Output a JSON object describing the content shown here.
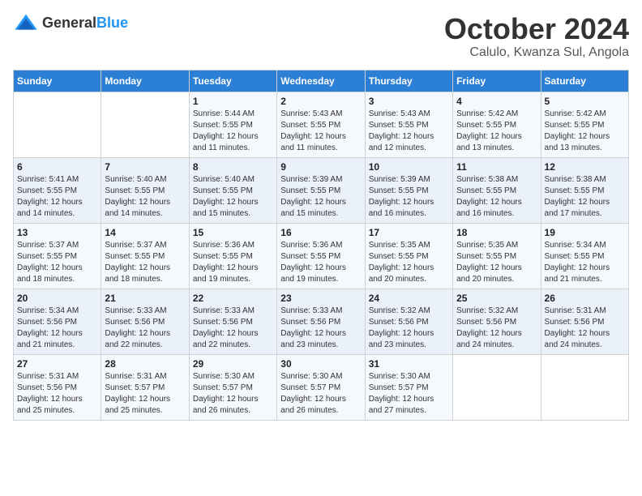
{
  "header": {
    "logo_general": "General",
    "logo_blue": "Blue",
    "month_title": "October 2024",
    "subtitle": "Calulo, Kwanza Sul, Angola"
  },
  "weekdays": [
    "Sunday",
    "Monday",
    "Tuesday",
    "Wednesday",
    "Thursday",
    "Friday",
    "Saturday"
  ],
  "weeks": [
    [
      {
        "day": "",
        "sunrise": "",
        "sunset": "",
        "daylight": ""
      },
      {
        "day": "",
        "sunrise": "",
        "sunset": "",
        "daylight": ""
      },
      {
        "day": "1",
        "sunrise": "Sunrise: 5:44 AM",
        "sunset": "Sunset: 5:55 PM",
        "daylight": "Daylight: 12 hours and 11 minutes."
      },
      {
        "day": "2",
        "sunrise": "Sunrise: 5:43 AM",
        "sunset": "Sunset: 5:55 PM",
        "daylight": "Daylight: 12 hours and 11 minutes."
      },
      {
        "day": "3",
        "sunrise": "Sunrise: 5:43 AM",
        "sunset": "Sunset: 5:55 PM",
        "daylight": "Daylight: 12 hours and 12 minutes."
      },
      {
        "day": "4",
        "sunrise": "Sunrise: 5:42 AM",
        "sunset": "Sunset: 5:55 PM",
        "daylight": "Daylight: 12 hours and 13 minutes."
      },
      {
        "day": "5",
        "sunrise": "Sunrise: 5:42 AM",
        "sunset": "Sunset: 5:55 PM",
        "daylight": "Daylight: 12 hours and 13 minutes."
      }
    ],
    [
      {
        "day": "6",
        "sunrise": "Sunrise: 5:41 AM",
        "sunset": "Sunset: 5:55 PM",
        "daylight": "Daylight: 12 hours and 14 minutes."
      },
      {
        "day": "7",
        "sunrise": "Sunrise: 5:40 AM",
        "sunset": "Sunset: 5:55 PM",
        "daylight": "Daylight: 12 hours and 14 minutes."
      },
      {
        "day": "8",
        "sunrise": "Sunrise: 5:40 AM",
        "sunset": "Sunset: 5:55 PM",
        "daylight": "Daylight: 12 hours and 15 minutes."
      },
      {
        "day": "9",
        "sunrise": "Sunrise: 5:39 AM",
        "sunset": "Sunset: 5:55 PM",
        "daylight": "Daylight: 12 hours and 15 minutes."
      },
      {
        "day": "10",
        "sunrise": "Sunrise: 5:39 AM",
        "sunset": "Sunset: 5:55 PM",
        "daylight": "Daylight: 12 hours and 16 minutes."
      },
      {
        "day": "11",
        "sunrise": "Sunrise: 5:38 AM",
        "sunset": "Sunset: 5:55 PM",
        "daylight": "Daylight: 12 hours and 16 minutes."
      },
      {
        "day": "12",
        "sunrise": "Sunrise: 5:38 AM",
        "sunset": "Sunset: 5:55 PM",
        "daylight": "Daylight: 12 hours and 17 minutes."
      }
    ],
    [
      {
        "day": "13",
        "sunrise": "Sunrise: 5:37 AM",
        "sunset": "Sunset: 5:55 PM",
        "daylight": "Daylight: 12 hours and 18 minutes."
      },
      {
        "day": "14",
        "sunrise": "Sunrise: 5:37 AM",
        "sunset": "Sunset: 5:55 PM",
        "daylight": "Daylight: 12 hours and 18 minutes."
      },
      {
        "day": "15",
        "sunrise": "Sunrise: 5:36 AM",
        "sunset": "Sunset: 5:55 PM",
        "daylight": "Daylight: 12 hours and 19 minutes."
      },
      {
        "day": "16",
        "sunrise": "Sunrise: 5:36 AM",
        "sunset": "Sunset: 5:55 PM",
        "daylight": "Daylight: 12 hours and 19 minutes."
      },
      {
        "day": "17",
        "sunrise": "Sunrise: 5:35 AM",
        "sunset": "Sunset: 5:55 PM",
        "daylight": "Daylight: 12 hours and 20 minutes."
      },
      {
        "day": "18",
        "sunrise": "Sunrise: 5:35 AM",
        "sunset": "Sunset: 5:55 PM",
        "daylight": "Daylight: 12 hours and 20 minutes."
      },
      {
        "day": "19",
        "sunrise": "Sunrise: 5:34 AM",
        "sunset": "Sunset: 5:55 PM",
        "daylight": "Daylight: 12 hours and 21 minutes."
      }
    ],
    [
      {
        "day": "20",
        "sunrise": "Sunrise: 5:34 AM",
        "sunset": "Sunset: 5:56 PM",
        "daylight": "Daylight: 12 hours and 21 minutes."
      },
      {
        "day": "21",
        "sunrise": "Sunrise: 5:33 AM",
        "sunset": "Sunset: 5:56 PM",
        "daylight": "Daylight: 12 hours and 22 minutes."
      },
      {
        "day": "22",
        "sunrise": "Sunrise: 5:33 AM",
        "sunset": "Sunset: 5:56 PM",
        "daylight": "Daylight: 12 hours and 22 minutes."
      },
      {
        "day": "23",
        "sunrise": "Sunrise: 5:33 AM",
        "sunset": "Sunset: 5:56 PM",
        "daylight": "Daylight: 12 hours and 23 minutes."
      },
      {
        "day": "24",
        "sunrise": "Sunrise: 5:32 AM",
        "sunset": "Sunset: 5:56 PM",
        "daylight": "Daylight: 12 hours and 23 minutes."
      },
      {
        "day": "25",
        "sunrise": "Sunrise: 5:32 AM",
        "sunset": "Sunset: 5:56 PM",
        "daylight": "Daylight: 12 hours and 24 minutes."
      },
      {
        "day": "26",
        "sunrise": "Sunrise: 5:31 AM",
        "sunset": "Sunset: 5:56 PM",
        "daylight": "Daylight: 12 hours and 24 minutes."
      }
    ],
    [
      {
        "day": "27",
        "sunrise": "Sunrise: 5:31 AM",
        "sunset": "Sunset: 5:56 PM",
        "daylight": "Daylight: 12 hours and 25 minutes."
      },
      {
        "day": "28",
        "sunrise": "Sunrise: 5:31 AM",
        "sunset": "Sunset: 5:57 PM",
        "daylight": "Daylight: 12 hours and 25 minutes."
      },
      {
        "day": "29",
        "sunrise": "Sunrise: 5:30 AM",
        "sunset": "Sunset: 5:57 PM",
        "daylight": "Daylight: 12 hours and 26 minutes."
      },
      {
        "day": "30",
        "sunrise": "Sunrise: 5:30 AM",
        "sunset": "Sunset: 5:57 PM",
        "daylight": "Daylight: 12 hours and 26 minutes."
      },
      {
        "day": "31",
        "sunrise": "Sunrise: 5:30 AM",
        "sunset": "Sunset: 5:57 PM",
        "daylight": "Daylight: 12 hours and 27 minutes."
      },
      {
        "day": "",
        "sunrise": "",
        "sunset": "",
        "daylight": ""
      },
      {
        "day": "",
        "sunrise": "",
        "sunset": "",
        "daylight": ""
      }
    ]
  ]
}
